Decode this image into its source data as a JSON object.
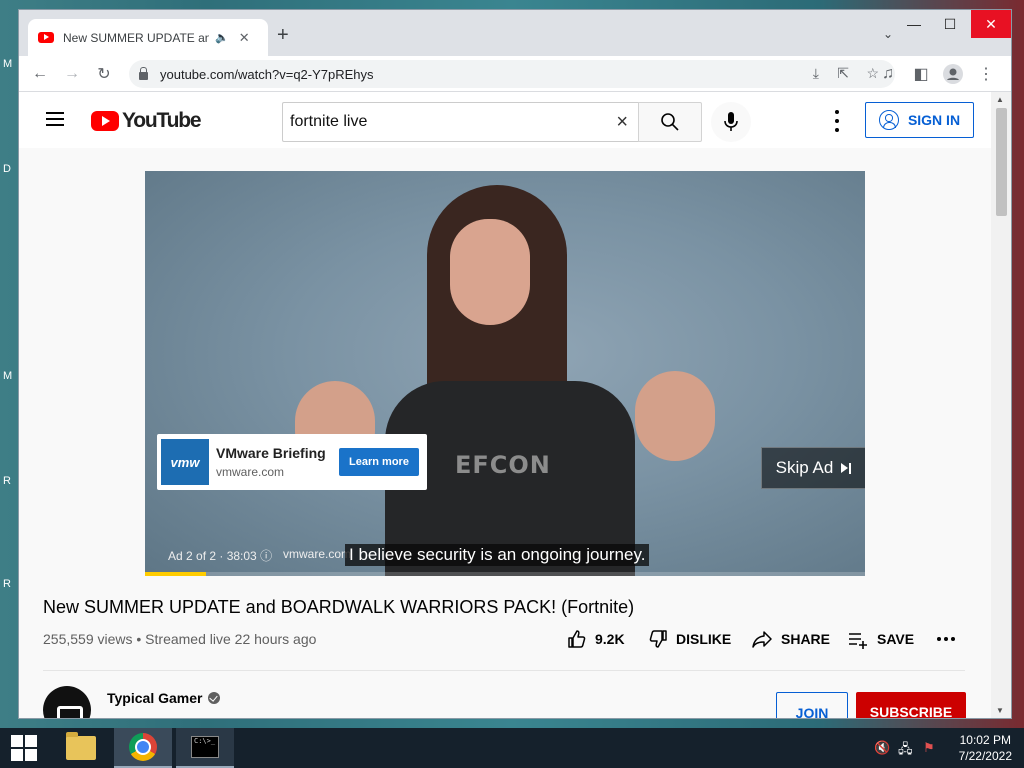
{
  "desktop": {
    "edge_glyphs": [
      "M",
      "D",
      "M",
      "R",
      "R"
    ]
  },
  "browser": {
    "tab": {
      "title": "New SUMMER UPDATE and BOARDWALK WARRIORS PACK! (Fortnite) - YouTube",
      "audio_icon": "speaker-icon",
      "close_glyph": "✕"
    },
    "new_tab_glyph": "+",
    "tab_search_glyph": "⌄",
    "window_controls": {
      "minimize": "—",
      "maximize": "☐",
      "close": "✕"
    },
    "nav": {
      "back": "←",
      "forward": "→",
      "reload": "↻"
    },
    "url": "youtube.com/watch?v=q2-Y7pREhys",
    "omnibox_icons": [
      "install-icon",
      "share-icon",
      "bookmark-star-icon"
    ],
    "toolbar_icons": [
      "media-control-icon",
      "side-panel-icon",
      "profile-icon",
      "menu-icon"
    ]
  },
  "youtube": {
    "logo_text": "YouTube",
    "search": {
      "value": "fortnite live",
      "placeholder": "Search"
    },
    "sign_in_label": "SIGN IN",
    "video": {
      "ad_card": {
        "logo_text": "vmw",
        "title": "VMware Briefing",
        "domain": "vmware.com",
        "cta": "Learn more"
      },
      "skip_label": "Skip Ad",
      "ad_info": "Ad 2 of 2 · 38:03 ⓘ",
      "ad_domain": "vmware.com",
      "caption": "I believe security is an ongoing journey.",
      "shirt_text": "EFCON",
      "ad_progress": 0.085,
      "accent_color": "#ffcc00"
    },
    "title": "New SUMMER UPDATE and BOARDWALK WARRIORS PACK! (Fortnite)",
    "meta": "255,559 views • Streamed live 22 hours ago",
    "actions": {
      "like_count": "9.2K",
      "dislike": "DISLIKE",
      "share": "SHARE",
      "save": "SAVE"
    },
    "channel": {
      "name": "Typical Gamer",
      "join": "JOIN",
      "subscribe": "SUBSCRIBE"
    }
  },
  "taskbar": {
    "time": "10:02 PM",
    "date": "7/22/2022",
    "cmd_glyph": "C:\\>_",
    "tray_icons": [
      "volume-muted-icon",
      "network-icon",
      "action-center-icon"
    ]
  },
  "colors": {
    "youtube_red": "#ff0000",
    "link_blue": "#065fd4",
    "subscribe_red": "#cc0000",
    "ad_cta_blue": "#1a73c9"
  }
}
